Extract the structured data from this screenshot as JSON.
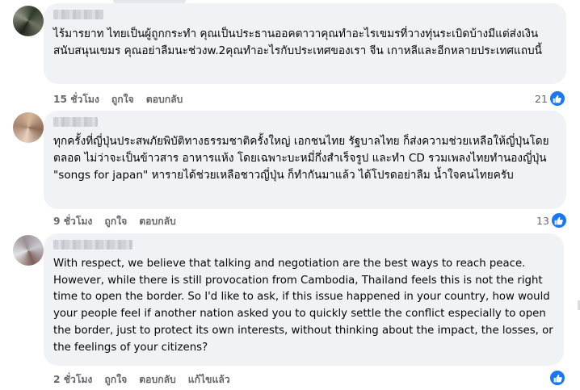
{
  "comments": [
    {
      "text": "ไร้มารยาท ไทยเป็นผู้ถูกกระทำ คุณเป็นประธานออคตาวาคุณทำอะไรเขมรที่วางทุ่นระเบิดบ้างมีแต่ส่งเงินสนับสนุนเขมร คุณอย่าลืมนะช่วงw.2คุณทำอะไรกับประเทศของเรา จีน เกาหลีและอีกหลายประเทศแถบนี้",
      "time": "15 ชั่วโมง",
      "like_label": "ถูกใจ",
      "reply_label": "ตอบกลับ",
      "reactions": "21"
    },
    {
      "text": "ทุกครั้งที่ญี่ปุ่นประสพภัยพิบัติทางธรรมชาติครั้งใหญ่ เอกชนไทย รัฐบาลไทย ก็ส่งความช่วยเหลือให้ญี่ปุ่นโดยตลอด ไม่ว่าจะเป็นข้าวสาร อาหารแห้ง โดยเฉพาะบะหมี่กึ่งสำเร็จรูป และทำ CD รวมเพลงไทยทำนองญี่ปุ่น \"songs for japan\" หารายได้ช่วยเหลือชาวญี่ปุ่น ก็ทำกันมาแล้ว ได้โปรดอย่าลืม น้ำใจคนไทยครับ",
      "time": "9 ชั่วโมง",
      "like_label": "ถูกใจ",
      "reply_label": "ตอบกลับ",
      "reactions": "13"
    },
    {
      "text": "With respect, we believe that talking and negotiation are the best ways to reach peace. However, while there is still provocation from Cambodia, Thailand feels this is not the right time to open the border. So I'd like to ask, if this issue happened in your country, how would your people feel if another nation asked you to quickly settle the conflict especially to open the border, just to protect its own interests, without thinking about the impact, the losses, or the feelings of your citizens?",
      "time": "2 ชั่วโมง",
      "like_label": "ถูกใจ",
      "reply_label": "ตอบกลับ",
      "edited_label": "แก้ไขแล้ว"
    }
  ],
  "colors": {
    "bubble": "#f0f2f5",
    "muted": "#65676b",
    "like": "#1877f2",
    "text": "#050505"
  },
  "icons": {
    "reaction": "like-thumb-icon",
    "avatar": "pixelated-avatar"
  }
}
